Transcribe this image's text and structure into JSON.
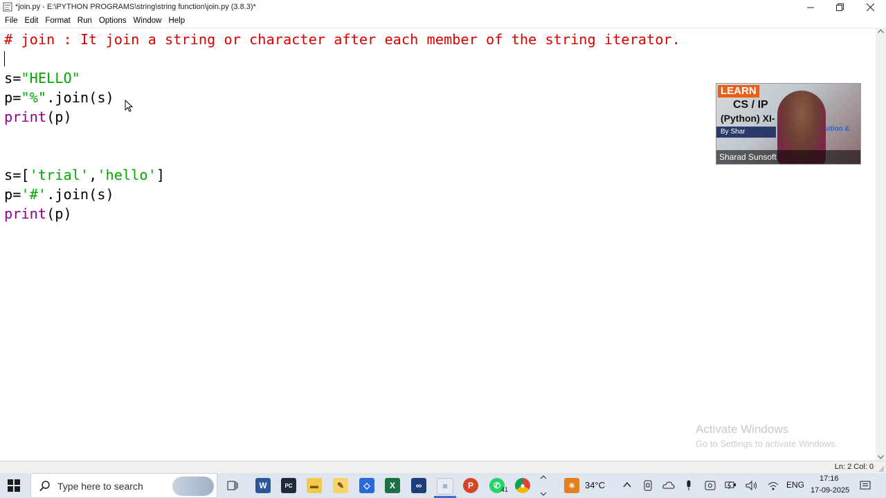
{
  "window": {
    "title": "*join.py - E:\\PYTHON PROGRAMS\\string\\string function\\join.py (3.8.3)*"
  },
  "menu": [
    "File",
    "Edit",
    "Format",
    "Run",
    "Options",
    "Window",
    "Help"
  ],
  "code": {
    "comment": "# join : It join a string or character after each member of the string iterator.",
    "block1": {
      "line1_var": "s=",
      "line1_str": "\"HELLO\"",
      "line2_var": "p=",
      "line2_str": "\"%\"",
      "line2_rest": ".join(s)",
      "line3_kw": "print",
      "line3_rest": "(p)"
    },
    "block2": {
      "line1_var": "s=[",
      "line1_str1": "'trial'",
      "line1_comma": ",",
      "line1_str2": "'hello'",
      "line1_end": "]",
      "line2_var": "p=",
      "line2_str": "'#'",
      "line2_rest": ".join(s)",
      "line3_kw": "print",
      "line3_rest": "(p)"
    }
  },
  "webcam": {
    "learn": "LEARN",
    "cs_ip": "CS / IP",
    "python": "(Python) XI-",
    "by": "By Shar",
    "tuition": "Tuition &",
    "name": "Sharad Sunsoft"
  },
  "watermark": {
    "title": "Activate Windows",
    "subtitle": "Go to Settings to activate Windows."
  },
  "status": {
    "position": "Ln: 2   Col: 0"
  },
  "taskbar": {
    "search_placeholder": "Type here to search",
    "weather": "34°C",
    "language": "ENG",
    "time": "17:16",
    "date": "17-09-2025",
    "whatsapp_badge": "41"
  },
  "colors": {
    "comment": "#dd0000",
    "string": "#00aa00",
    "keyword": "#900090"
  }
}
